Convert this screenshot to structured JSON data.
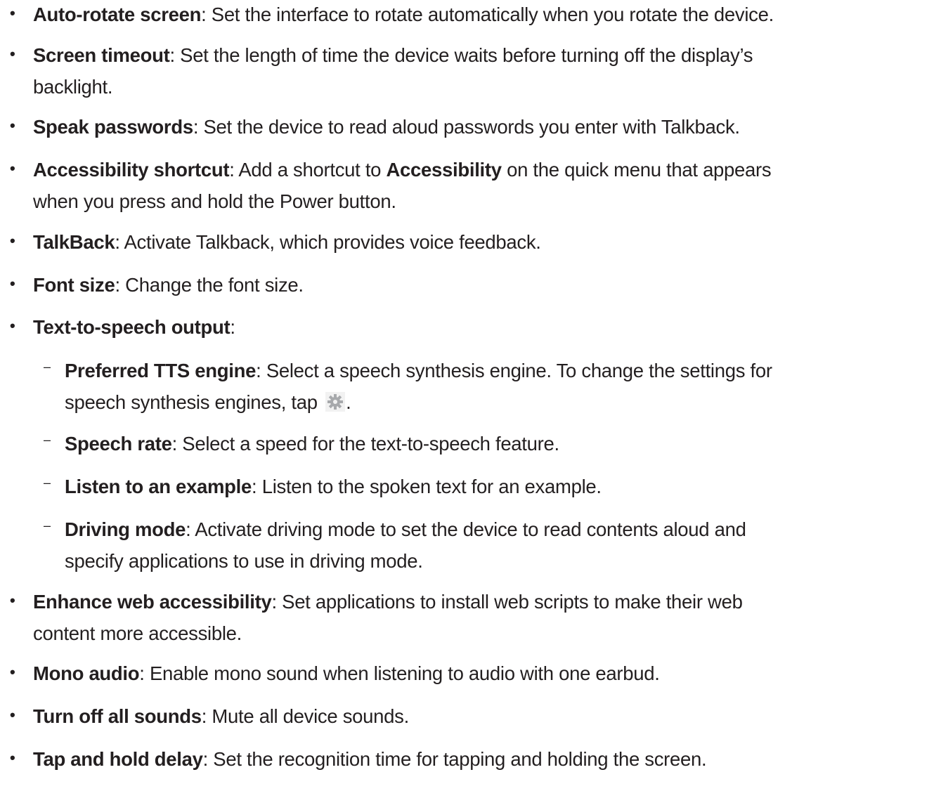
{
  "items": [
    {
      "level": 1,
      "term": "Auto-rotate screen",
      "text": ": Set the interface to rotate automatically when you rotate the device."
    },
    {
      "level": 1,
      "term": "Screen timeout",
      "text": ": Set the length of time the device waits before turning off the display’s",
      "text2": "backlight."
    },
    {
      "level": 1,
      "term": "Speak passwords",
      "text": ": Set the device to read aloud passwords you enter with Talkback."
    },
    {
      "level": 1,
      "term": "Accessibility shortcut",
      "text_a": ": Add a shortcut to ",
      "term2": "Accessibility",
      "text_b": " on the quick menu that appears",
      "text2": "when you press and hold the Power button."
    },
    {
      "level": 1,
      "term": "TalkBack",
      "text": ": Activate Talkback, which provides voice feedback."
    },
    {
      "level": 1,
      "term": "Font size",
      "text": ": Change the font size."
    },
    {
      "level": 1,
      "term": "Text-to-speech output",
      "text": ":"
    },
    {
      "level": 2,
      "term": "Preferred TTS engine",
      "text": ": Select a speech synthesis engine. To change the settings for",
      "text2": "speech synthesis engines, tap ",
      "icon": "gear-icon",
      "text3": "."
    },
    {
      "level": 2,
      "term": "Speech rate",
      "text": ": Select a speed for the text-to-speech feature."
    },
    {
      "level": 2,
      "term": "Listen to an example",
      "text": ": Listen to the spoken text for an example."
    },
    {
      "level": 2,
      "term": "Driving mode",
      "text": ": Activate driving mode to set the device to read contents aloud and",
      "text2": "specify applications to use in driving mode."
    },
    {
      "level": 1,
      "term": "Enhance web accessibility",
      "text": ": Set applications to install web scripts to make their web",
      "text2": "content more accessible."
    },
    {
      "level": 1,
      "term": "Mono audio",
      "text": ": Enable mono sound when listening to audio with one earbud."
    },
    {
      "level": 1,
      "term": "Turn off all sounds",
      "text": ": Mute all device sounds."
    },
    {
      "level": 1,
      "term": "Tap and hold delay",
      "text": ": Set the recognition time for tapping and holding the screen."
    }
  ],
  "markers": {
    "bullet": "•",
    "dash": "–"
  },
  "colors": {
    "text": "#231f20",
    "icon_bg": "#f2f2f2",
    "icon_fg": "#a7a9ac"
  }
}
